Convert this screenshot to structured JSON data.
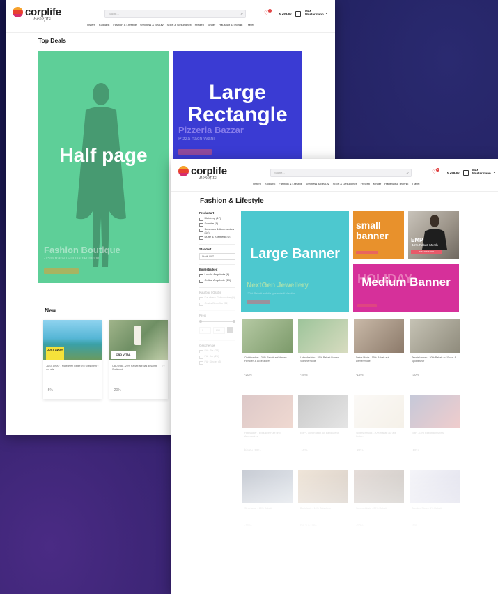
{
  "brand": {
    "name": "corplife",
    "tagline": "Benefits"
  },
  "header": {
    "search_placeholder": "Suche...",
    "nav": [
      "Ostern",
      "Kulinarik",
      "Fashion & Lifestyle",
      "Wellness & Beauty",
      "Sport & Gesundheit",
      "Freizeit",
      "Kinder",
      "Haushalt & Technik",
      "Travel"
    ],
    "notification_count": "3",
    "balance": "€ 298,80",
    "user_name": "Max Mustermann"
  },
  "window_a": {
    "section_title": "Top Deals",
    "half_page": {
      "label": "Half page",
      "ghost_title": "Fashion Boutique",
      "ghost_sub": "-15% Rabatt auf Damenmode",
      "ghost_btn": "ZUM ANGEBOT"
    },
    "rectangle": {
      "label": "Large Rectangle",
      "ghost_title": "Pizzeria Bazzar",
      "ghost_sub": "Pizza nach Wahl",
      "ghost_btn": "ZUM ANGEBOT"
    },
    "new_title": "Neu",
    "cards": [
      {
        "badge": "JUST AWAY",
        "title": "JUST AWAY - Malediven Reise 5% Gutschein auf alle...",
        "discount": "-5%"
      },
      {
        "badge": "CBD VITAL",
        "title": "CBD Vital - 20% Rabatt auf das gesamte Sortiment",
        "discount": "-20%"
      }
    ]
  },
  "window_b": {
    "page_title": "Fashion & Lifestyle",
    "filters": {
      "produktart_title": "Produktart",
      "produktart": [
        "Kleidung (17)",
        "Schuhe (8)",
        "Schmuck & Accessoires (14)",
        "Düfte & Kosmetik (1)"
      ],
      "standort_title": "Standort",
      "standort_value": "Stadt, PLZ...",
      "einloese_title": "Einlösbarkeit",
      "einloese": [
        "Lokale Angebote (6)",
        "Online Angebote (29)"
      ],
      "kaufbar_title": "Kaufbar / Gratis",
      "kaufbar": [
        "Kaufbare Gutscheine (0)",
        "Gratis Benefits (31)"
      ],
      "preis_title": "Preis",
      "preis_from": "0",
      "preis_to": "250",
      "geschenke_title": "Geschenke",
      "geschenke": [
        "Für Sie (24)",
        "Für Ihn (21)",
        "Für Kinder (5)"
      ]
    },
    "large_banner": {
      "label": "Large Banner",
      "ghost_title": "NextGen Jewellery",
      "ghost_sub": "-20% Rabatt auf die gesamte Kollektion"
    },
    "small_banner": {
      "label": "small banner"
    },
    "emp_banner": {
      "title": "EMP",
      "sub": "-15% Rabatt Merch",
      "btn": "ZUM ANGEBOT"
    },
    "medium_banner": {
      "label": "Medium Banner",
      "ghost_title": "HOLIDAY"
    },
    "row1": [
      {
        "title": "Outfitmacher - 20% Rabatt auf Herren-Hemden & Accessoires",
        "price": "-20%"
      },
      {
        "title": "Urbanfashion - 25% Rabatt Damen Sommermode",
        "price": "-25%"
      },
      {
        "title": "Deine Mode - 15% Rabatt auf Damenmode",
        "price": "-15%"
      },
      {
        "title": "Tennis Herren - 30% Rabatt auf Polos & Sportswear",
        "price": "-30%"
      }
    ],
    "row2": [
      {
        "title": "Hutmacher - Exklusive Hüte und Accessoires",
        "price": "bis zu -50%"
      },
      {
        "title": "EMP - 15% Rabatt auf Band-Merch",
        "price": "-15%"
      },
      {
        "title": "Silberschmuck - 20% Rabatt auf alle Ketten",
        "price": "-20%"
      },
      {
        "title": "EMP - 10% Rabatt auf Shirts",
        "price": "-10%"
      }
    ],
    "row3": [
      {
        "title": "Streetwear - 15% Rabatt",
        "price": "-15%"
      },
      {
        "title": "Bastelwelt - 10% Gutschein",
        "price": "bis zu -10%"
      },
      {
        "title": "Schmuckkiste - 20% Rabatt",
        "price": "-20%"
      },
      {
        "title": "Sneaker Store - 5% Rabatt",
        "price": "-5%"
      }
    ]
  },
  "colors": {
    "half_page_bg": "#5ecf98",
    "rectangle_bg": "#3a3bd3",
    "large_banner_bg": "#4dc8cf",
    "small_banner_bg": "#e8912c",
    "medium_banner_bg": "#d6309a",
    "accent_red": "#e04040"
  }
}
